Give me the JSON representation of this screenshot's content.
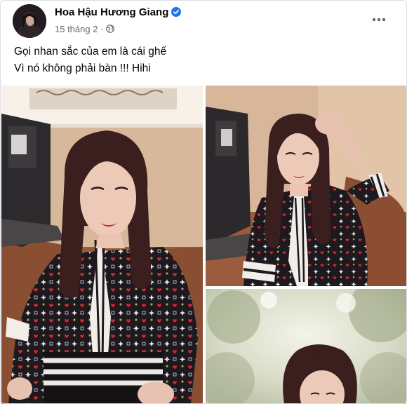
{
  "post": {
    "author": "Hoa Hậu Hương Giang",
    "verified_icon": "verified-badge-icon",
    "date": "15 tháng 2",
    "separator": "·",
    "privacy_icon": "globe-icon",
    "more_icon": "more-options-icon",
    "caption_lines": [
      "Gọi nhan sắc của em là cái ghế",
      "Vì nó không phải bàn !!! Hihi"
    ]
  },
  "photos": [
    {
      "label": "photo-1"
    },
    {
      "label": "photo-2"
    },
    {
      "label": "photo-3"
    }
  ],
  "colors": {
    "name": "#050505",
    "meta": "#65676b",
    "verified": "#1877f2",
    "border": "#dcdfe4"
  }
}
